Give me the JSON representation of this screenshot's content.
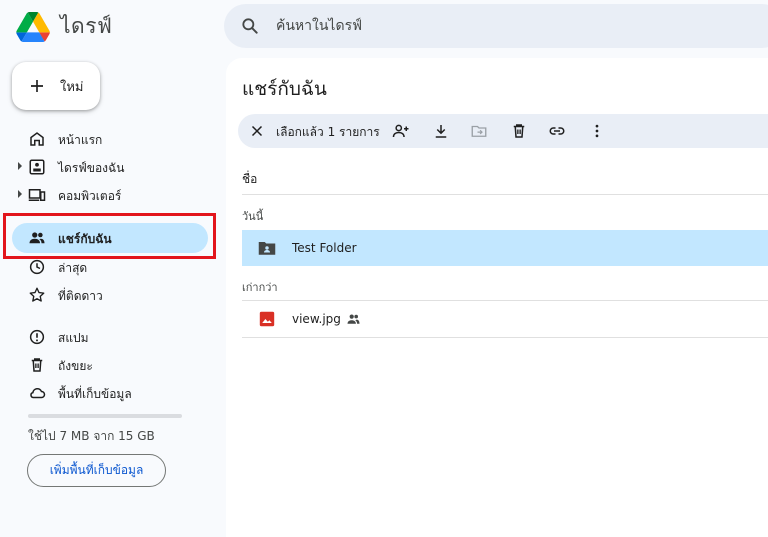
{
  "app": {
    "title": "ไดรฟ์"
  },
  "search": {
    "placeholder": "ค้นหาในไดรฟ์"
  },
  "new_button": {
    "label": "ใหม่"
  },
  "sidebar": {
    "items": [
      {
        "label": "หน้าแรก",
        "icon": "home-icon"
      },
      {
        "label": "ไดรฟ์ของฉัน",
        "icon": "my-drive-icon"
      },
      {
        "label": "คอมพิวเตอร์",
        "icon": "computer-icon"
      },
      {
        "label": "แชร์กับฉัน",
        "icon": "shared-icon",
        "active": true
      },
      {
        "label": "ล่าสุด",
        "icon": "clock-icon"
      },
      {
        "label": "ที่ติดดาว",
        "icon": "star-icon"
      },
      {
        "label": "สแปม",
        "icon": "spam-icon"
      },
      {
        "label": "ถังขยะ",
        "icon": "trash-icon"
      },
      {
        "label": "พื้นที่เก็บข้อมูล",
        "icon": "cloud-icon"
      }
    ]
  },
  "storage": {
    "usage_text": "ใช้ไป 7 MB จาก 15 GB",
    "button_label": "เพิ่มพื้นที่เก็บข้อมูล",
    "used_fraction": 0.0005
  },
  "main": {
    "title": "แชร์กับฉัน",
    "toolbar": {
      "selection_text": "เลือกแล้ว 1 รายการ",
      "actions": [
        "close-icon",
        "add-person-icon",
        "download-icon",
        "move-icon",
        "delete-icon",
        "link-icon",
        "more-icon"
      ]
    },
    "column_name": "ชื่อ",
    "sections": [
      {
        "label": "วันนี้",
        "files": [
          {
            "name": "Test Folder",
            "type": "shared-folder-icon",
            "selected": true
          }
        ]
      },
      {
        "label": "เก่ากว่า",
        "files": [
          {
            "name": "view.jpg",
            "type": "image-file-icon",
            "shared": true
          }
        ]
      }
    ]
  },
  "colors": {
    "accent": "#c2e7ff",
    "highlight_box": "#e2151c",
    "link": "#0b57d0"
  }
}
